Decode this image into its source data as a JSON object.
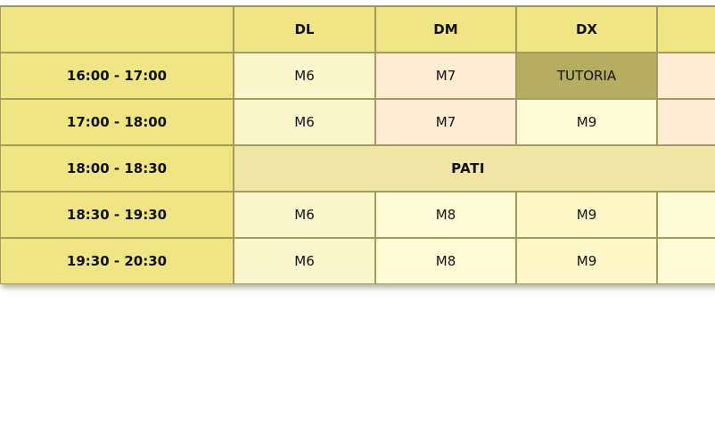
{
  "days": [
    "DL",
    "DM",
    "DX",
    ""
  ],
  "rows": [
    {
      "time": "16:00 - 17:00",
      "cells": [
        "M6",
        "M7",
        "TUTORIA",
        ""
      ]
    },
    {
      "time": "17:00 - 18:00",
      "cells": [
        "M6",
        "M7",
        "M9",
        ""
      ]
    },
    {
      "time": "18:00 - 18:30",
      "break_label": "PATI"
    },
    {
      "time": "18:30 - 19:30",
      "cells": [
        "M6",
        "M8",
        "M9",
        ""
      ]
    },
    {
      "time": "19:30 - 20:30",
      "cells": [
        "M6",
        "M8",
        "M9",
        ""
      ]
    }
  ],
  "colors": {
    "header": "#efe585",
    "cell_light": "#faf7cf",
    "cell_peach": "#feecd3",
    "cell_cream": "#fffcd6",
    "tutoria": "#b6ad63",
    "break": "#efe5a4",
    "break_text": "#5a5a2a"
  }
}
